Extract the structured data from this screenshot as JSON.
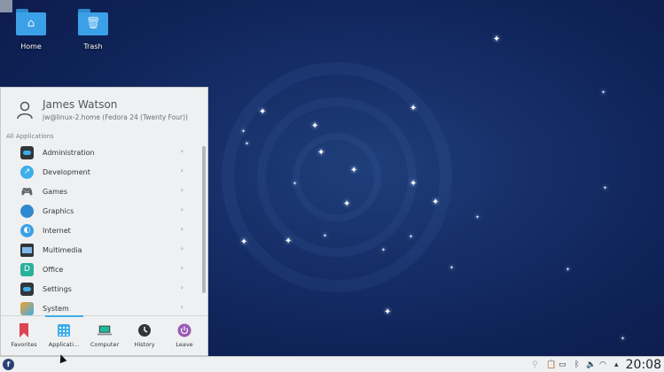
{
  "desktop": {
    "icons": [
      {
        "label": "Home",
        "icon": "home-folder-icon"
      },
      {
        "label": "Trash",
        "icon": "trash-folder-icon"
      }
    ]
  },
  "launcher": {
    "user": {
      "name": "James Watson",
      "subtitle": "jw@linux-2.home (Fedora 24 (Twenty Four))"
    },
    "section_label": "All Applications",
    "items": [
      {
        "label": "Administration",
        "icon": "administration-icon",
        "color": "#31363b"
      },
      {
        "label": "Development",
        "icon": "development-icon",
        "color": "#3daee9"
      },
      {
        "label": "Games",
        "icon": "gamepad-icon",
        "color": "#31363b"
      },
      {
        "label": "Graphics",
        "icon": "graphics-icon",
        "color": "#2e8ad0"
      },
      {
        "label": "Internet",
        "icon": "globe-icon",
        "color": "#3ba0e6"
      },
      {
        "label": "Multimedia",
        "icon": "multimedia-icon",
        "color": "#31363b"
      },
      {
        "label": "Office",
        "icon": "office-icon",
        "color": "#2ab09c"
      },
      {
        "label": "Settings",
        "icon": "settings-icon",
        "color": "#31363b"
      },
      {
        "label": "System",
        "icon": "system-icon",
        "color": "#f0a030"
      }
    ],
    "tabs": [
      {
        "label": "Favorites",
        "icon": "bookmark-icon",
        "active": false
      },
      {
        "label": "Applicati...",
        "icon": "applications-grid-icon",
        "active": true
      },
      {
        "label": "Computer",
        "icon": "computer-icon",
        "active": false
      },
      {
        "label": "History",
        "icon": "history-icon",
        "active": false
      },
      {
        "label": "Leave",
        "icon": "power-icon",
        "active": false
      }
    ]
  },
  "taskbar": {
    "clock": "20:08",
    "tray_icons": [
      "pin-icon",
      "clipboard-icon",
      "battery-icon",
      "bluetooth-icon",
      "volume-icon",
      "wifi-icon",
      "expand-up-icon"
    ]
  },
  "colors": {
    "accent": "#3daee9",
    "panel_bg": "#eff0f1",
    "desktop_bg": "#10245a"
  }
}
